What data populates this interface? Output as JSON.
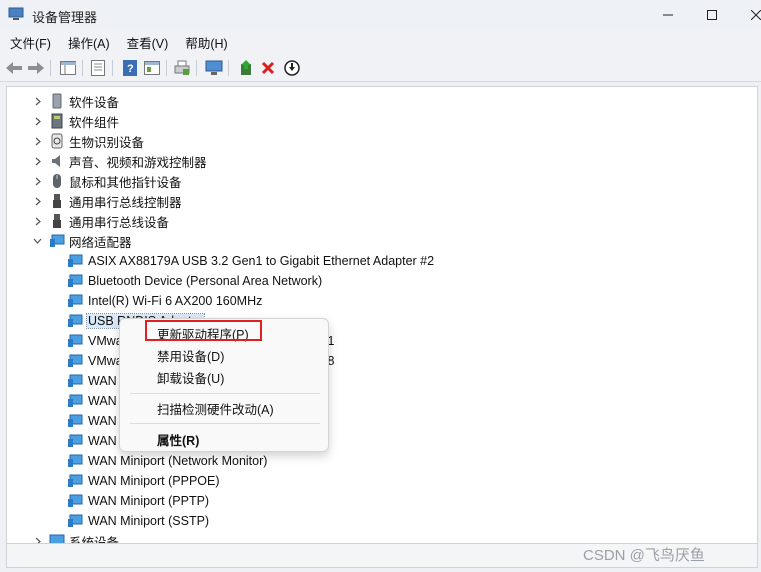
{
  "window": {
    "title": "设备管理器"
  },
  "menu": [
    "文件(F)",
    "操作(A)",
    "查看(V)",
    "帮助(H)"
  ],
  "tree": {
    "categories_top": [
      {
        "label": "软件设备",
        "icon": "software-device-icon",
        "expanded": false
      },
      {
        "label": "软件组件",
        "icon": "software-component-icon",
        "expanded": false
      },
      {
        "label": "生物识别设备",
        "icon": "biometric-icon",
        "expanded": false
      },
      {
        "label": "声音、视频和游戏控制器",
        "icon": "speaker-icon",
        "expanded": false
      },
      {
        "label": "鼠标和其他指针设备",
        "icon": "mouse-icon",
        "expanded": false
      },
      {
        "label": "通用串行总线控制器",
        "icon": "usb-icon",
        "expanded": false
      },
      {
        "label": "通用串行总线设备",
        "icon": "usb-icon",
        "expanded": false
      }
    ],
    "network": {
      "label": "网络适配器",
      "expanded": true,
      "adapters": [
        "ASIX AX88179A USB 3.2 Gen1 to Gigabit Ethernet Adapter #2",
        "Bluetooth Device (Personal Area Network)",
        "Intel(R) Wi-Fi 6 AX200 160MHz",
        "USB RNDIS Adapter",
        "VMware Virtual Ethernet Adapter for VMnet1",
        "VMware Virtual Ethernet Adapter for VMnet8",
        "WAN Miniport (IKEv2)",
        "WAN Miniport (IP)",
        "WAN Miniport (IPv6)",
        "WAN Miniport (L2TP)",
        "WAN Miniport (Network Monitor)",
        "WAN Miniport (PPPOE)",
        "WAN Miniport (PPTP)",
        "WAN Miniport (SSTP)"
      ],
      "selected_index": 3
    },
    "categories_bottom": [
      {
        "label": "系统设备",
        "icon": "system-device-icon",
        "expanded": false
      }
    ]
  },
  "context_menu": {
    "items": [
      "更新驱动程序(P)",
      "禁用设备(D)",
      "卸载设备(U)",
      "扫描检测硬件改动(A)",
      "属性(R)"
    ]
  },
  "watermark": "CSDN @飞鸟厌鱼",
  "colors": {
    "highlight_box": "#e02020",
    "selection": "#dbe8f7"
  }
}
